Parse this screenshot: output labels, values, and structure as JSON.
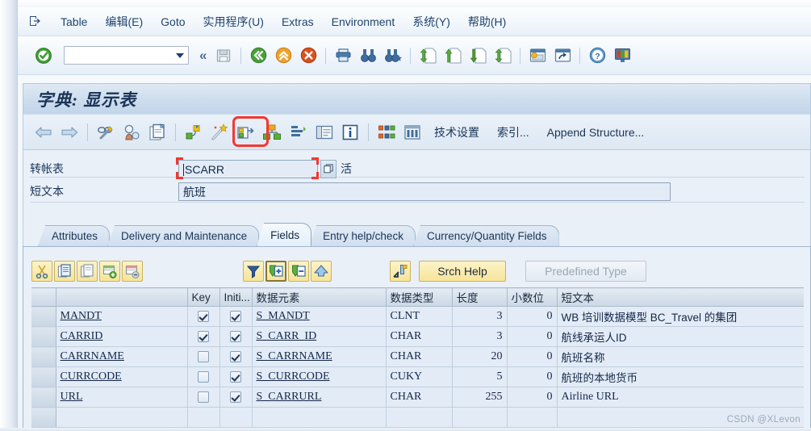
{
  "window": {
    "title": "字典: 显示表",
    "watermark": "CSDN @XLevon"
  },
  "menubar": {
    "icon": "table-doc-icon",
    "items": [
      {
        "label": "Table",
        "accel": ""
      },
      {
        "label": "编辑(E)",
        "accel": "E"
      },
      {
        "label": "Goto",
        "accel": "G"
      },
      {
        "label": "实用程序(U)",
        "accel": "U"
      },
      {
        "label": "Extras",
        "accel": "a"
      },
      {
        "label": "Environment",
        "accel": "v"
      },
      {
        "label": "系统(Y)",
        "accel": "Y"
      },
      {
        "label": "帮助(H)",
        "accel": "H"
      }
    ]
  },
  "toolbar": {
    "command_value": "",
    "command_placeholder": "",
    "icons": [
      "enter-check-icon",
      "collapse-chevrons-icon",
      "save-icon",
      "back-green-icon",
      "exit-orange-icon",
      "cancel-red-icon",
      "print-icon",
      "find-icon",
      "find-next-icon",
      "first-page-icon",
      "previous-page-icon",
      "next-page-icon",
      "last-page-icon",
      "new-window-icon",
      "create-shortcut-icon",
      "help-icon",
      "layout-menu-icon"
    ]
  },
  "app_toolbar": {
    "icons": [
      "back-arrow-icon",
      "forward-arrow-icon",
      "display-change-icon",
      "check-icon",
      "copy-template-icon",
      "hierarchy-small-icon",
      "magic-wand-icon",
      "extend-icon",
      "graphic-hierarchy-icon",
      "indexes-list-icon",
      "documentation-icon",
      "info-icon",
      "structure-display-icon",
      "table-contents-icon"
    ],
    "highlighted_icon": "graphic-hierarchy-icon",
    "buttons": [
      "技术设置",
      "索引...",
      "Append Structure..."
    ]
  },
  "form": {
    "rows": [
      {
        "label": "转帐表",
        "value": "SCARR",
        "has_picker": true,
        "status": "活"
      },
      {
        "label": "短文本",
        "value": "航班",
        "has_picker": false,
        "status": ""
      }
    ]
  },
  "tabs": [
    {
      "label": "Attributes",
      "active": false
    },
    {
      "label": "Delivery and Maintenance",
      "active": false
    },
    {
      "label": "Fields",
      "active": true
    },
    {
      "label": "Entry help/check",
      "active": false
    },
    {
      "label": "Currency/Quantity Fields",
      "active": false
    }
  ],
  "grid_toolbar": {
    "icons": [
      "cut-icon",
      "copy-icon",
      "paste-icon",
      "insert-row-icon",
      "delete-row-icon",
      "sort-filter-icon",
      "append-row-icon",
      "remove-row-icon",
      "move-up-icon",
      "srch-help-icon"
    ],
    "buttons": [
      {
        "label": "Srch Help",
        "disabled": false
      },
      {
        "label": "Predefined Type",
        "disabled": true
      }
    ]
  },
  "fields_table": {
    "columns": [
      "",
      "",
      "Key",
      "Initi...",
      "数据元素",
      "数据类型",
      "长度",
      "小数位",
      "短文本"
    ],
    "rows": [
      {
        "field": "MANDT",
        "key": true,
        "initial": true,
        "data_element": "S_MANDT",
        "data_type": "CLNT",
        "length": "3",
        "decimals": "0",
        "short_text": "WB 培训数据模型 BC_Travel 的集团"
      },
      {
        "field": "CARRID",
        "key": true,
        "initial": true,
        "data_element": "S_CARR_ID",
        "data_type": "CHAR",
        "length": "3",
        "decimals": "0",
        "short_text": "航线承运人ID"
      },
      {
        "field": "CARRNAME",
        "key": false,
        "initial": true,
        "data_element": "S_CARRNAME",
        "data_type": "CHAR",
        "length": "20",
        "decimals": "0",
        "short_text": "航班名称"
      },
      {
        "field": "CURRCODE",
        "key": false,
        "initial": true,
        "data_element": "S_CURRCODE",
        "data_type": "CUKY",
        "length": "5",
        "decimals": "0",
        "short_text": "航班的本地货币"
      },
      {
        "field": "URL",
        "key": false,
        "initial": true,
        "data_element": "S_CARRURL",
        "data_type": "CHAR",
        "length": "255",
        "decimals": "0",
        "short_text": "Airline URL"
      },
      {
        "field": "",
        "key": null,
        "initial": null,
        "data_element": "",
        "data_type": "",
        "length": "",
        "decimals": "",
        "short_text": ""
      }
    ]
  },
  "colors": {
    "accent": "#1b3557",
    "highlight": "#f4372f",
    "button_yellow": "#f6e49a",
    "grid_bg": "#e3ecf6"
  }
}
